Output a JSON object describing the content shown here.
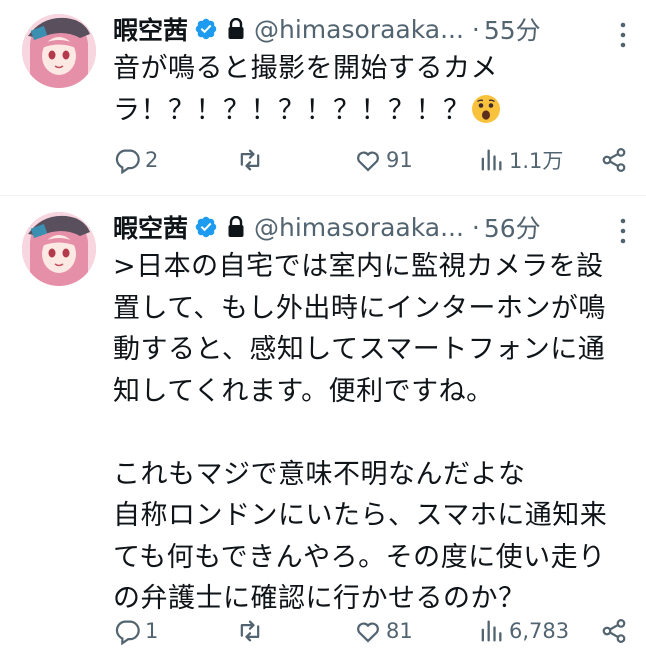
{
  "tweets": [
    {
      "name": "暇空茜",
      "handle": "@himasoraaka...",
      "separator": "·",
      "time": "55分",
      "text": "音が鳴ると撮影を開始するカメ\nラ！？！？！？！？！？！？",
      "emoji": "astonished-face-emoji",
      "replies": "2",
      "retweets": "",
      "likes": "91",
      "views": "1.1万"
    },
    {
      "name": "暇空茜",
      "handle": "@himasoraaka...",
      "separator": "·",
      "time": "56分",
      "text": ">日本の自宅では室内に監視カメラを設\n置して、もし外出時にインターホンが鳴\n動すると、感知してスマートフォンに通\n知してくれます。便利ですね。\n\nこれもマジで意味不明なんだよな\n自称ロンドンにいたら、スマホに通知来\nても何もできんやろ。その度に使い走り\nの弁護士に確認に行かせるのか？",
      "replies": "1",
      "retweets": "",
      "likes": "81",
      "views": "6,783"
    }
  ],
  "colors": {
    "text": "#0f1419",
    "secondary": "#536471",
    "verified": "#1d9bf0",
    "divider": "#eff3f4"
  },
  "icons": [
    "verified-badge-icon",
    "lock-icon",
    "more-icon",
    "reply-icon",
    "retweet-icon",
    "like-icon",
    "views-icon",
    "share-icon"
  ]
}
